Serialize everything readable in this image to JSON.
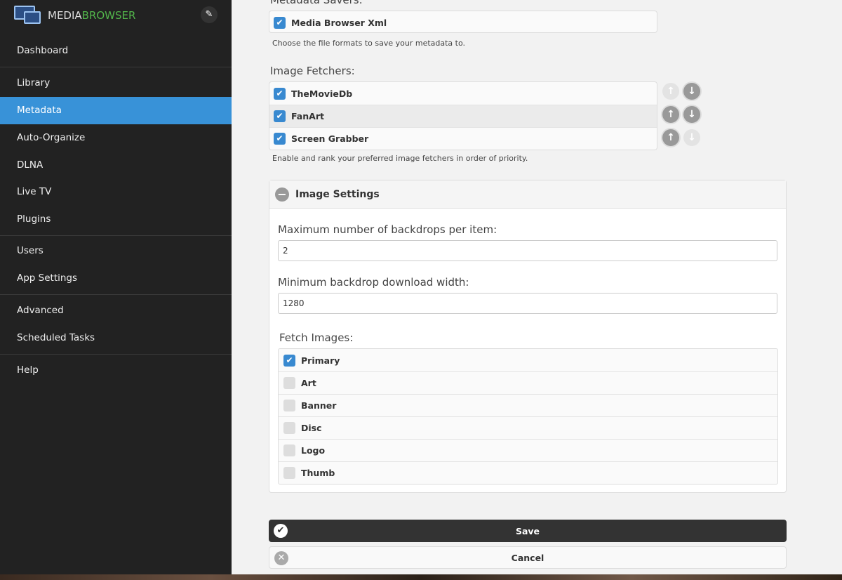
{
  "app": {
    "logo_part1": "MEDIA",
    "logo_part2": "BROWSER"
  },
  "sidebar": {
    "items": [
      {
        "label": "Dashboard"
      },
      {
        "label": "Library"
      },
      {
        "label": "Metadata",
        "active": true
      },
      {
        "label": "Auto-Organize"
      },
      {
        "label": "DLNA"
      },
      {
        "label": "Live TV"
      },
      {
        "label": "Plugins"
      },
      {
        "label": "Users"
      },
      {
        "label": "App Settings"
      },
      {
        "label": "Advanced"
      },
      {
        "label": "Scheduled Tasks"
      },
      {
        "label": "Help"
      }
    ]
  },
  "savers": {
    "label": "Metadata Savers:",
    "items": [
      {
        "label": "Media Browser Xml",
        "checked": true
      }
    ],
    "help": "Choose the file formats to save your metadata to."
  },
  "fetchers": {
    "label": "Image Fetchers:",
    "items": [
      {
        "label": "TheMovieDb",
        "checked": true
      },
      {
        "label": "FanArt",
        "checked": true
      },
      {
        "label": "Screen Grabber",
        "checked": true
      }
    ],
    "help": "Enable and rank your preferred image fetchers in order of priority."
  },
  "image_settings": {
    "title": "Image Settings",
    "max_backdrops_label": "Maximum number of backdrops per item:",
    "max_backdrops_value": "2",
    "min_width_label": "Minimum backdrop download width:",
    "min_width_value": "1280",
    "fetch_label": "Fetch Images:",
    "fetch_items": [
      {
        "label": "Primary",
        "checked": true
      },
      {
        "label": "Art",
        "checked": false
      },
      {
        "label": "Banner",
        "checked": false
      },
      {
        "label": "Disc",
        "checked": false
      },
      {
        "label": "Logo",
        "checked": false
      },
      {
        "label": "Thumb",
        "checked": false
      }
    ]
  },
  "buttons": {
    "save": "Save",
    "cancel": "Cancel"
  },
  "colors": {
    "accent": "#3892d8",
    "brand_green": "#52b54b",
    "sidebar_bg": "#222222"
  }
}
